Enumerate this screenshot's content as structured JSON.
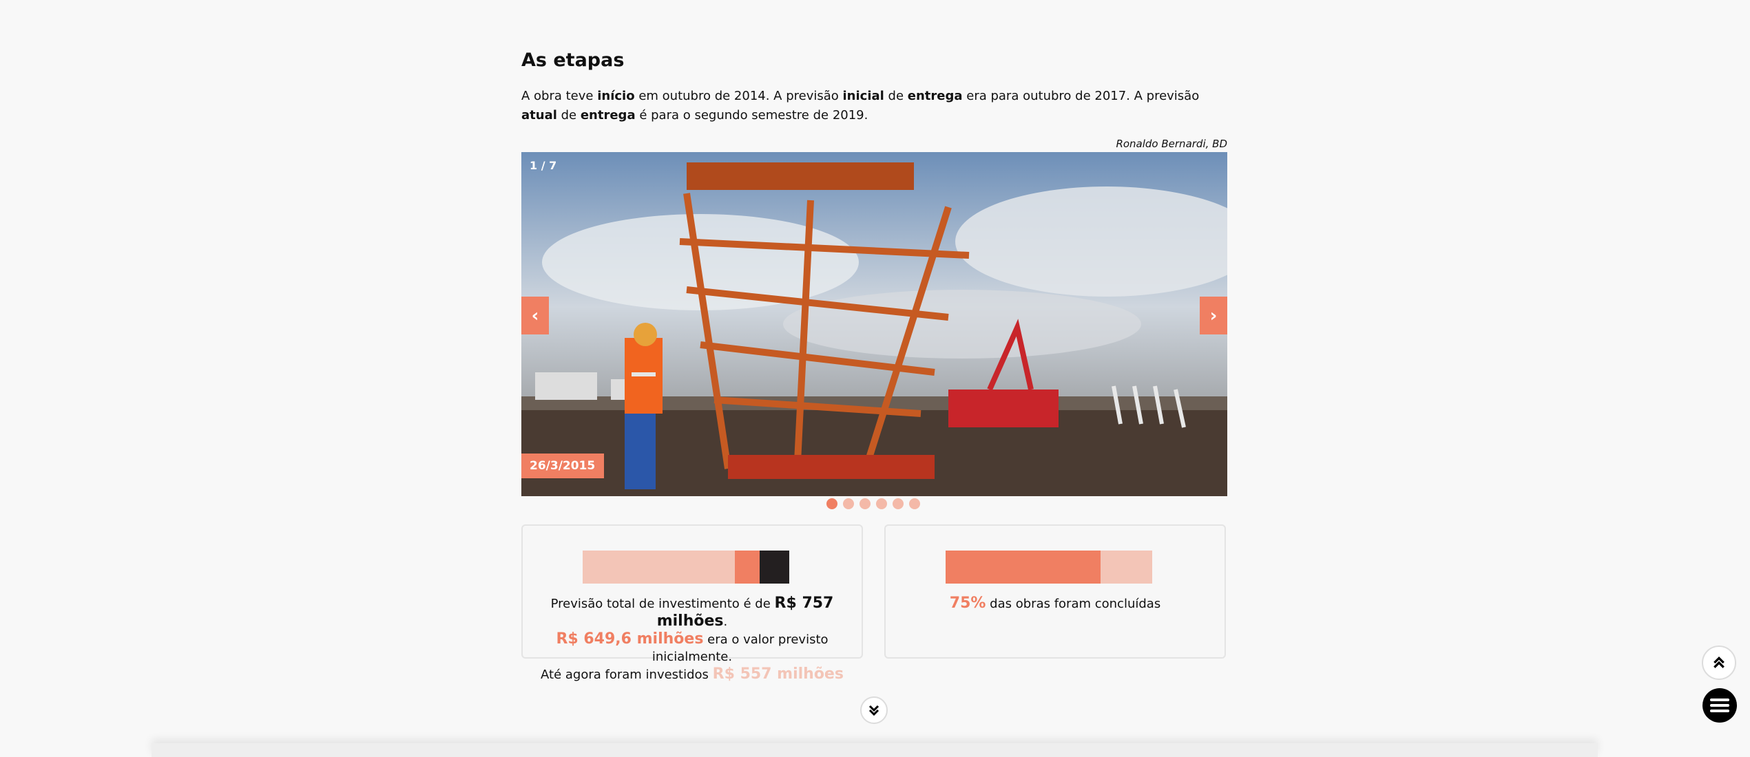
{
  "section": {
    "title": "As etapas",
    "intro": {
      "p1": "A obra teve ",
      "b1": "início",
      "p2": " em outubro de 2014. A previsão ",
      "b2": "inicial",
      "p3": " de ",
      "b3": "entrega",
      "p4": " era para outubro de 2017. A previsão ",
      "b4": "atual",
      "p5": " de ",
      "b5": "entrega",
      "p6": " é para o segundo semestre de 2019."
    }
  },
  "gallery": {
    "credit": "Ronaldo Bernardi, BD",
    "counter": "1 / 7",
    "date": "26/3/2015",
    "prev_label": "‹",
    "next_label": "›",
    "photo_alt": "Workers next to an orange steel tower at a construction site",
    "dots_count": 6,
    "active_dot": 0
  },
  "investment_card": {
    "bar": {
      "initial": 649.6,
      "invested": 557,
      "total": 757
    },
    "t1": "Previsão total de investimento é de ",
    "total": "R$ 757 milhões",
    "t2": ".",
    "initial": "R$ 649,6 milhões",
    "t3": " era o valor previsto inicialmente.",
    "t4": "Até agora foram investidos ",
    "invested": "R$ 557 milhões"
  },
  "progress_card": {
    "percent_value": 0.75,
    "percent": "75%",
    "text": " das obras foram concluídas"
  },
  "colors": {
    "accent": "#f07f62",
    "accent_light": "#f3c5b7",
    "dark": "#231f20"
  },
  "icons": {
    "scroll_down": "double-chevron-down-icon",
    "scroll_top": "double-chevron-up-icon",
    "menu": "hamburger-menu-icon"
  }
}
